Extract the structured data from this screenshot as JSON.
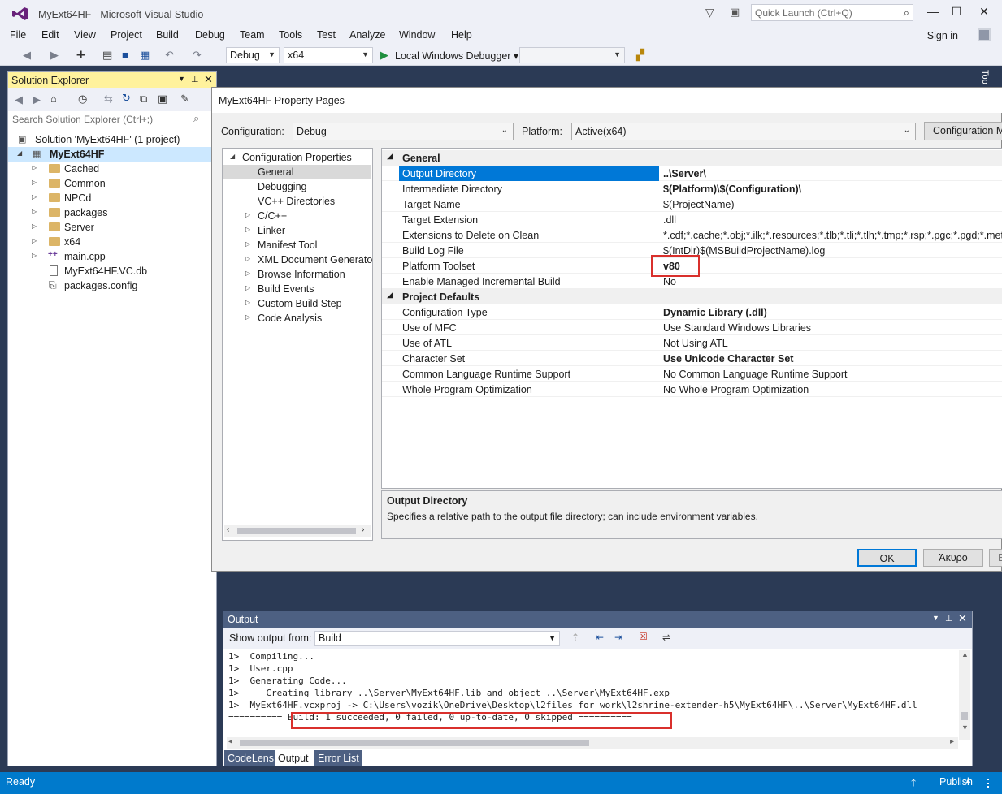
{
  "window": {
    "title": "MyExt64HF - Microsoft Visual Studio",
    "quick_launch_placeholder": "Quick Launch (Ctrl+Q)",
    "sign_in": "Sign in"
  },
  "menu": [
    "File",
    "Edit",
    "View",
    "Project",
    "Build",
    "Debug",
    "Team",
    "Tools",
    "Test",
    "Analyze",
    "Window",
    "Help"
  ],
  "toolbar": {
    "configuration": "Debug",
    "platform": "x64",
    "debugger": "Local Windows Debugger"
  },
  "solution_explorer": {
    "title": "Solution Explorer",
    "search_placeholder": "Search Solution Explorer (Ctrl+;)",
    "solution": "Solution 'MyExt64HF' (1 project)",
    "project": "MyExt64HF",
    "items": [
      {
        "label": "Cached",
        "type": "folder"
      },
      {
        "label": "Common",
        "type": "folder"
      },
      {
        "label": "NPCd",
        "type": "folder"
      },
      {
        "label": "packages",
        "type": "folder"
      },
      {
        "label": "Server",
        "type": "folder"
      },
      {
        "label": "x64",
        "type": "folder"
      },
      {
        "label": "main.cpp",
        "type": "cpp"
      },
      {
        "label": "MyExt64HF.VC.db",
        "type": "file"
      },
      {
        "label": "packages.config",
        "type": "file"
      }
    ]
  },
  "dialog": {
    "title": "MyExt64HF Property Pages",
    "configuration_label": "Configuration:",
    "configuration_value": "Debug",
    "platform_label": "Platform:",
    "platform_value": "Active(x64)",
    "config_manager_button": "Configuration Manager...",
    "tree": {
      "root": "Configuration Properties",
      "items": [
        {
          "label": "General",
          "expandable": false,
          "selected": true
        },
        {
          "label": "Debugging",
          "expandable": false
        },
        {
          "label": "VC++ Directories",
          "expandable": false
        },
        {
          "label": "C/C++",
          "expandable": true
        },
        {
          "label": "Linker",
          "expandable": true
        },
        {
          "label": "Manifest Tool",
          "expandable": true
        },
        {
          "label": "XML Document Generator",
          "expandable": true
        },
        {
          "label": "Browse Information",
          "expandable": true
        },
        {
          "label": "Build Events",
          "expandable": true
        },
        {
          "label": "Custom Build Step",
          "expandable": true
        },
        {
          "label": "Code Analysis",
          "expandable": true
        }
      ]
    },
    "categories": {
      "general": "General",
      "project_defaults": "Project Defaults"
    },
    "general_props": [
      {
        "name": "Output Directory",
        "value": "..\\Server\\",
        "bold": true
      },
      {
        "name": "Intermediate Directory",
        "value": "$(Platform)\\$(Configuration)\\",
        "bold": true
      },
      {
        "name": "Target Name",
        "value": "$(ProjectName)",
        "bold": false
      },
      {
        "name": "Target Extension",
        "value": ".dll",
        "bold": false
      },
      {
        "name": "Extensions to Delete on Clean",
        "value": "*.cdf;*.cache;*.obj;*.ilk;*.resources;*.tlb;*.tli;*.tlh;*.tmp;*.rsp;*.pgc;*.pgd;*.meta;*.tlog;",
        "bold": false
      },
      {
        "name": "Build Log File",
        "value": "$(IntDir)$(MSBuildProjectName).log",
        "bold": false
      },
      {
        "name": "Platform Toolset",
        "value": "v80",
        "bold": true
      },
      {
        "name": "Enable Managed Incremental Build",
        "value": "No",
        "bold": false
      }
    ],
    "default_props": [
      {
        "name": "Configuration Type",
        "value": "Dynamic Library (.dll)",
        "bold": true
      },
      {
        "name": "Use of MFC",
        "value": "Use Standard Windows Libraries",
        "bold": false
      },
      {
        "name": "Use of ATL",
        "value": "Not Using ATL",
        "bold": false
      },
      {
        "name": "Character Set",
        "value": "Use Unicode Character Set",
        "bold": true
      },
      {
        "name": "Common Language Runtime Support",
        "value": "No Common Language Runtime Support",
        "bold": false
      },
      {
        "name": "Whole Program Optimization",
        "value": "No Whole Program Optimization",
        "bold": false
      }
    ],
    "description_title": "Output Directory",
    "description_text": "Specifies a relative path to the output file directory; can include environment variables.",
    "ok": "OK",
    "cancel": "Άκυρο",
    "apply": "Εφαρμογή"
  },
  "output": {
    "title": "Output",
    "show_from_label": "Show output from:",
    "show_from_value": "Build",
    "lines": [
      "1>  Compiling...",
      "1>  User.cpp",
      "1>  Generating Code...",
      "1>     Creating library ..\\Server\\MyExt64HF.lib and object ..\\Server\\MyExt64HF.exp",
      "1>  MyExt64HF.vcxproj -> C:\\Users\\vozik\\OneDrive\\Desktop\\l2files_for_work\\l2shrine-extender-h5\\MyExt64HF\\..\\Server\\MyExt64HF.dll",
      "========== Build: 1 succeeded, 0 failed, 0 up-to-date, 0 skipped =========="
    ],
    "tabs": [
      "CodeLens",
      "Output",
      "Error List"
    ]
  },
  "status": {
    "text": "Ready",
    "publish": "Publish"
  },
  "colors": {
    "accent": "#007acc",
    "selection": "#0078d7",
    "highlight_box": "#d9302c",
    "tool_header": "#fff29d"
  }
}
